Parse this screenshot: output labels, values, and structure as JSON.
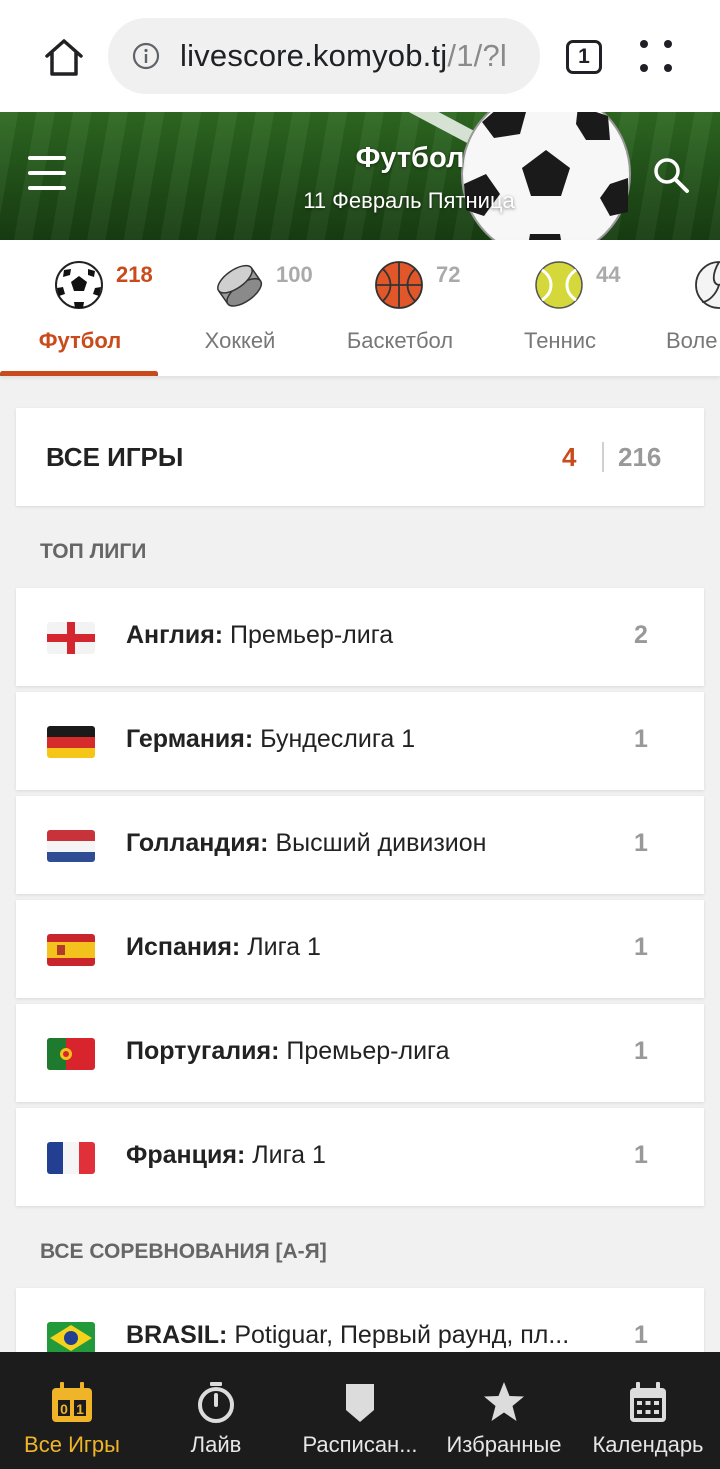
{
  "browser": {
    "url_main": "livescore.komyob.tj",
    "url_rest": "/1/?l",
    "tab_count": "1"
  },
  "header": {
    "title": "Футбол",
    "date": "11 Февраль Пятница"
  },
  "sports": [
    {
      "label": "Футбол",
      "count": "218",
      "icon": "soccer-ball-icon"
    },
    {
      "label": "Хоккей",
      "count": "100",
      "icon": "hockey-puck-icon"
    },
    {
      "label": "Баскетбол",
      "count": "72",
      "icon": "basketball-icon"
    },
    {
      "label": "Теннис",
      "count": "44",
      "icon": "tennis-ball-icon"
    },
    {
      "label": "Воле",
      "count": "",
      "icon": "volleyball-icon"
    }
  ],
  "all_games": {
    "title": "ВСЕ ИГРЫ",
    "live": "4",
    "total": "216"
  },
  "top_leagues": {
    "heading": "ТОП ЛИГИ",
    "items": [
      {
        "country": "Англия:",
        "league": " Премьер-лига",
        "count": "2",
        "flag": "england-flag-icon"
      },
      {
        "country": "Германия:",
        "league": " Бундеслига 1",
        "count": "1",
        "flag": "germany-flag-icon"
      },
      {
        "country": "Голландия:",
        "league": " Высший дивизион",
        "count": "1",
        "flag": "netherlands-flag-icon"
      },
      {
        "country": "Испания:",
        "league": " Лига 1",
        "count": "1",
        "flag": "spain-flag-icon"
      },
      {
        "country": "Португалия:",
        "league": " Премьер-лига",
        "count": "1",
        "flag": "portugal-flag-icon"
      },
      {
        "country": "Франция:",
        "league": " Лига 1",
        "count": "1",
        "flag": "france-flag-icon"
      }
    ]
  },
  "all_competitions": {
    "heading": "ВСЕ СОРЕВНОВАНИЯ [А-Я]",
    "items": [
      {
        "country": "BRASIL:",
        "league": " Potiguar, Первый раунд, пл...",
        "count": "1",
        "flag": "brazil-flag-icon"
      }
    ]
  },
  "bottom_nav": [
    {
      "label": "Все Игры",
      "icon": "scoreboard-icon",
      "active": true
    },
    {
      "label": "Лайв",
      "icon": "stopwatch-icon",
      "active": false
    },
    {
      "label": "Расписан...",
      "icon": "shield-icon",
      "active": false
    },
    {
      "label": "Избранные",
      "icon": "star-icon",
      "active": false
    },
    {
      "label": "Календарь",
      "icon": "calendar-icon",
      "active": false
    }
  ],
  "colors": {
    "accent": "#c94a1a",
    "nav_active": "#f0b429",
    "nav_bg": "#1c1c1c"
  }
}
